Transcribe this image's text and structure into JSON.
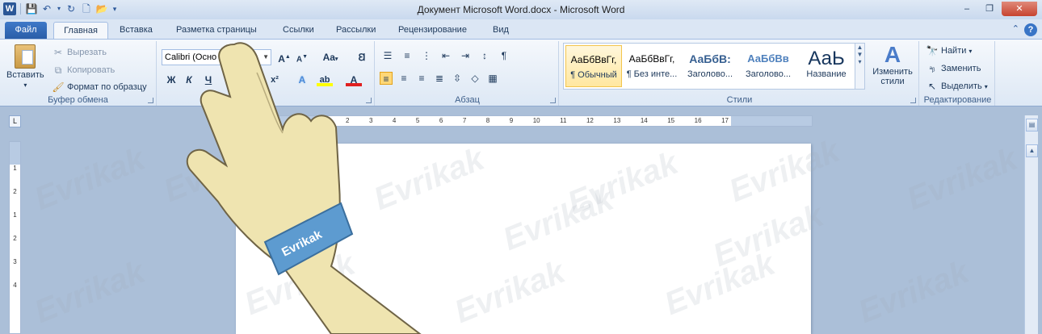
{
  "window": {
    "title": "Документ Microsoft Word.docx  -  Microsoft Word",
    "buttons": [
      "–",
      "❐",
      "✕"
    ]
  },
  "qat": {
    "app_icon_letter": "W"
  },
  "tabs": {
    "file": "Файл",
    "items": [
      "Главная",
      "Вставка",
      "Разметка страницы",
      "Ссылки",
      "Рассылки",
      "Рецензирование",
      "Вид"
    ]
  },
  "clipboard": {
    "paste": "Вставить",
    "cut": "Вырезать",
    "copy": "Копировать",
    "format_painter": "Формат по образцу",
    "label": "Буфер обмена"
  },
  "font": {
    "name": "Calibri (Осно",
    "size": "",
    "grow": "A",
    "shrink": "A",
    "change_case": "Aa",
    "bold": "Ж",
    "italic": "К",
    "underline": "Ч",
    "superscript": "x²",
    "text_effects": "A",
    "highlight": "ab",
    "font_color": "A"
  },
  "paragraph": {
    "label": "Абзац"
  },
  "styles": {
    "label": "Стили",
    "items": [
      {
        "sample": "АаБбВвГг,",
        "name": "¶ Обычный"
      },
      {
        "sample": "АаБбВвГг,",
        "name": "¶ Без инте..."
      },
      {
        "sample": "АаБбВ:",
        "name": "Заголово..."
      },
      {
        "sample": "АаБбВв",
        "name": "Заголово..."
      },
      {
        "sample": "АаЬ",
        "name": "Название"
      }
    ],
    "change_styles": "Изменить стили"
  },
  "editing": {
    "find": "Найти",
    "replace": "Заменить",
    "select": "Выделить",
    "label": "Редактирование"
  },
  "ruler": {
    "corner": "L",
    "ticks": [
      "1",
      "2",
      "3",
      "4",
      "5",
      "6",
      "7",
      "8",
      "9",
      "10",
      "11",
      "12",
      "13",
      "14",
      "15",
      "16",
      "17"
    ],
    "vticks": [
      "1",
      "2",
      "1",
      "2",
      "3",
      "4"
    ]
  },
  "watermark": "Evrikak",
  "colors": {
    "file_tab": "#2a5da8",
    "highlight_selected": "#f2c54d",
    "accent": "#2b579a"
  }
}
